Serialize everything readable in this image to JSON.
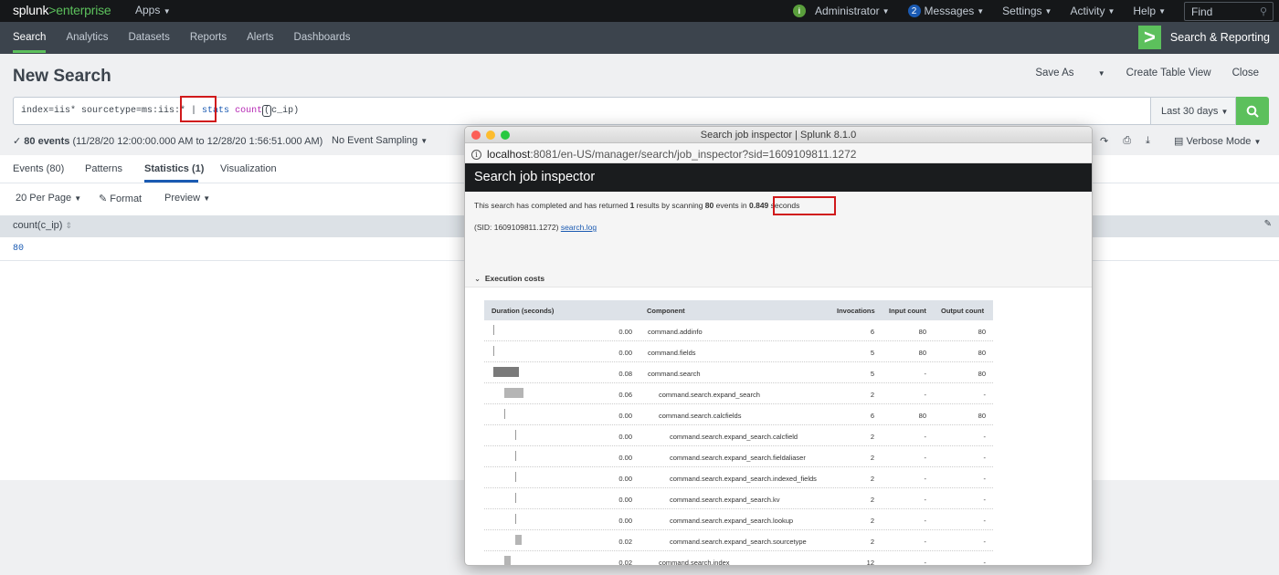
{
  "topbar": {
    "logo_main": "splunk",
    "logo_gt": ">",
    "logo_product": "enterprise",
    "apps_label": "Apps",
    "admin_badge": "i",
    "admin_label": "Administrator",
    "messages_count": "2",
    "messages_label": "Messages",
    "settings_label": "Settings",
    "activity_label": "Activity",
    "help_label": "Help",
    "find_placeholder": "Find"
  },
  "appbar": {
    "nav": [
      "Search",
      "Analytics",
      "Datasets",
      "Reports",
      "Alerts",
      "Dashboards"
    ],
    "active": "Search",
    "app_name": "Search & Reporting",
    "accent_color": "#5cc05c"
  },
  "page": {
    "title": "New Search",
    "actions": {
      "save_as": "Save As",
      "create_table_view": "Create Table View",
      "close": "Close"
    }
  },
  "search": {
    "query_prefix": "index=iis* sourcetype=ms:iis:* | ",
    "query_kw": "stats",
    "query_fn": "count",
    "query_paren": "(",
    "query_rest": "c_ip)",
    "time_range": "Last 30 days"
  },
  "status": {
    "events_label": "80 events",
    "range": "(11/28/20 12:00:00.000 AM to 12/28/20 1:56:51.000 AM)",
    "sampling": "No Event Sampling",
    "mode": "Verbose Mode"
  },
  "tabs": [
    {
      "label": "Events (80)",
      "active": false
    },
    {
      "label": "Patterns",
      "active": false
    },
    {
      "label": "Statistics (1)",
      "active": true
    },
    {
      "label": "Visualization",
      "active": false
    }
  ],
  "tools": {
    "per_page": "20 Per Page",
    "format": "Format",
    "preview": "Preview"
  },
  "results": {
    "column": "count(c_ip)",
    "value": "80"
  },
  "inspector": {
    "window_title": "Search job inspector | Splunk 8.1.0",
    "url_host": "localhost",
    "url_path": ":8081/en-US/manager/search/job_inspector?sid=1609109811.1272",
    "header": "Search job inspector",
    "summary_pre": "This search has completed and has returned ",
    "results_count": "1",
    "summary_mid": " results by scanning ",
    "events_count": "80",
    "summary_mid2": " events in ",
    "seconds": "0.849",
    "summary_post": " seconds",
    "sid_text": "(SID: 1609109811.1272) ",
    "search_log_link": "search.log",
    "section_label": "Execution costs",
    "columns": [
      "Duration (seconds)",
      "Component",
      "Invocations",
      "Input count",
      "Output count"
    ],
    "rows": [
      {
        "duration": "0.00",
        "component": "command.addinfo",
        "invocations": "6",
        "input": "80",
        "output": "80",
        "level": 0,
        "bar": 0.0
      },
      {
        "duration": "0.00",
        "component": "command.fields",
        "invocations": "5",
        "input": "80",
        "output": "80",
        "level": 0,
        "bar": 0.0
      },
      {
        "duration": "0.08",
        "component": "command.search",
        "invocations": "5",
        "input": "-",
        "output": "80",
        "level": 0,
        "bar": 0.08
      },
      {
        "duration": "0.06",
        "component": "command.search.expand_search",
        "invocations": "2",
        "input": "-",
        "output": "-",
        "level": 1,
        "bar": 0.06
      },
      {
        "duration": "0.00",
        "component": "command.search.calcfields",
        "invocations": "6",
        "input": "80",
        "output": "80",
        "level": 1,
        "bar": 0.0
      },
      {
        "duration": "0.00",
        "component": "command.search.expand_search.calcfield",
        "invocations": "2",
        "input": "-",
        "output": "-",
        "level": 2,
        "bar": 0.0
      },
      {
        "duration": "0.00",
        "component": "command.search.expand_search.fieldaliaser",
        "invocations": "2",
        "input": "-",
        "output": "-",
        "level": 2,
        "bar": 0.0
      },
      {
        "duration": "0.00",
        "component": "command.search.expand_search.indexed_fields",
        "invocations": "2",
        "input": "-",
        "output": "-",
        "level": 2,
        "bar": 0.0
      },
      {
        "duration": "0.00",
        "component": "command.search.expand_search.kv",
        "invocations": "2",
        "input": "-",
        "output": "-",
        "level": 2,
        "bar": 0.0
      },
      {
        "duration": "0.00",
        "component": "command.search.expand_search.lookup",
        "invocations": "2",
        "input": "-",
        "output": "-",
        "level": 2,
        "bar": 0.0
      },
      {
        "duration": "0.02",
        "component": "command.search.expand_search.sourcetype",
        "invocations": "2",
        "input": "-",
        "output": "-",
        "level": 2,
        "bar": 0.02
      },
      {
        "duration": "0.02",
        "component": "command.search.index",
        "invocations": "12",
        "input": "-",
        "output": "-",
        "level": 1,
        "bar": 0.02
      }
    ]
  },
  "colors": {
    "highlight_box": "#d0191b",
    "search_green": "#5cc05c",
    "link_blue": "#1a5ab2"
  }
}
